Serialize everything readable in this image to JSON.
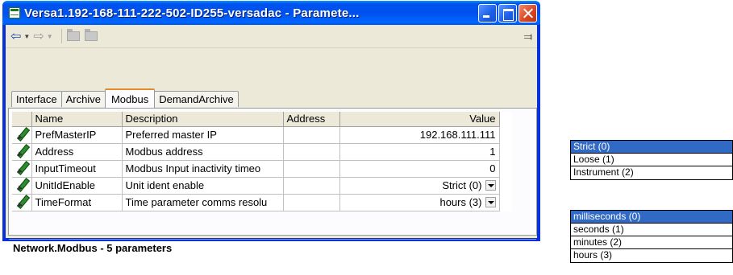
{
  "window": {
    "title": "Versa1.192-168-111-222-502-ID255-versadac - Paramete..."
  },
  "tabs": [
    "Interface",
    "Archive",
    "Modbus",
    "DemandArchive"
  ],
  "active_tab": "Modbus",
  "table": {
    "columns": [
      "Name",
      "Description",
      "Address",
      "Value"
    ],
    "rows": [
      {
        "name": "PrefMasterIP",
        "description": "Preferred master IP",
        "address": "",
        "value": "192.168.111.111",
        "has_dropdown": false
      },
      {
        "name": "Address",
        "description": "Modbus address",
        "address": "",
        "value": "1",
        "has_dropdown": false
      },
      {
        "name": "InputTimeout",
        "description": "Modbus Input inactivity timeo",
        "address": "",
        "value": "0",
        "has_dropdown": false
      },
      {
        "name": "UnitIdEnable",
        "description": "Unit ident enable",
        "address": "",
        "value": "Strict (0)",
        "has_dropdown": true
      },
      {
        "name": "TimeFormat",
        "description": "Time parameter comms resolu",
        "address": "",
        "value": "hours (3)",
        "has_dropdown": true
      }
    ]
  },
  "status": {
    "text": "Network.Modbus  -  5 parameters"
  },
  "unit_id_options": {
    "options": [
      "Strict (0)",
      "Loose (1)",
      "Instrument (2)"
    ],
    "selected": "Strict (0)"
  },
  "time_format_options": {
    "options": [
      "milliseconds (0)",
      "seconds (1)",
      "minutes (2)",
      "hours (3)"
    ],
    "selected": "milliseconds (0)"
  },
  "colors": {
    "title_blue": "#0050ee",
    "selection": "#316ac5",
    "active_tab_accent": "#e68b2c",
    "face": "#ece9d8"
  }
}
